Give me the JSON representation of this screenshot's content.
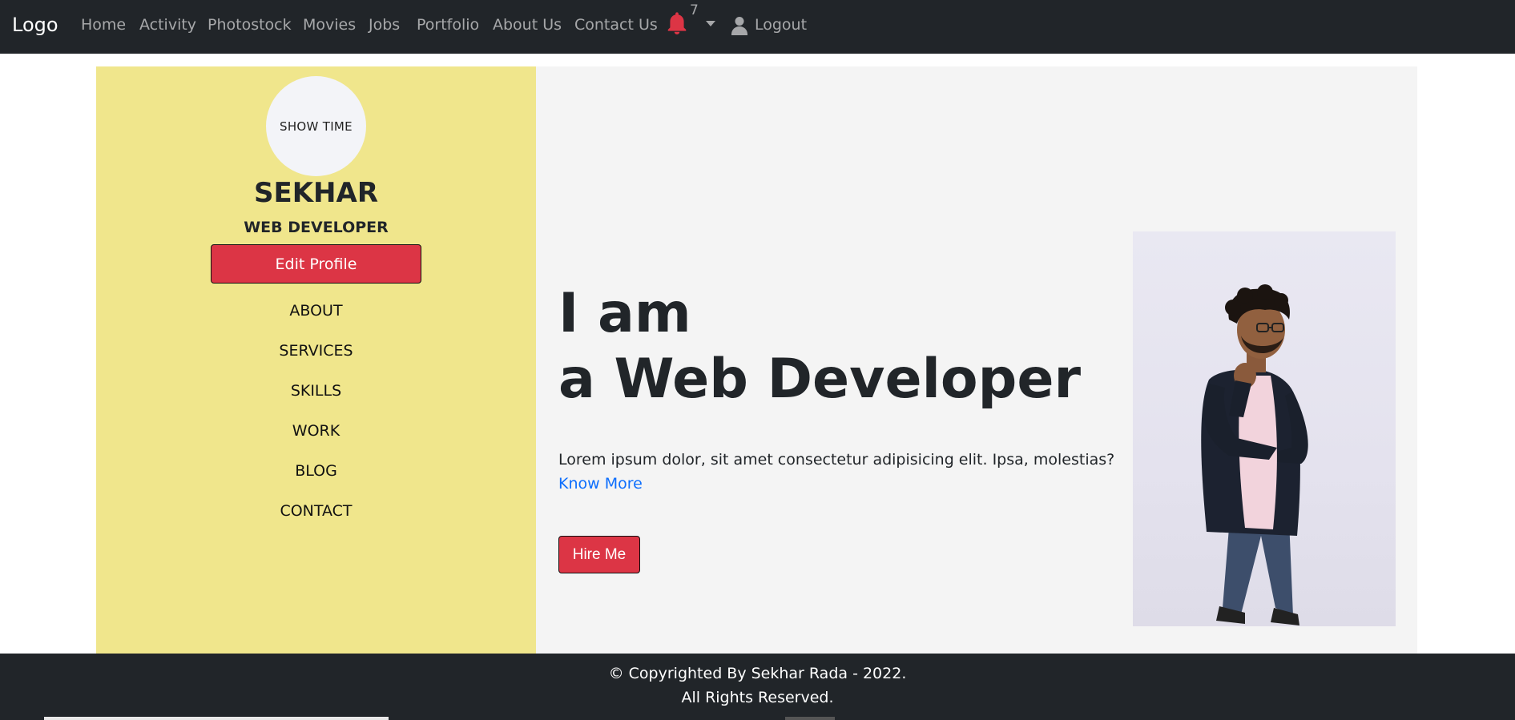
{
  "navbar": {
    "brand": "Logo",
    "links": [
      "Home",
      "Activity",
      "Photostock",
      "Movies",
      "Jobs",
      "Portfolio",
      "About Us",
      "Contact Us"
    ],
    "notification_count": "7",
    "logout_label": "Logout",
    "icons": [
      "bell-icon",
      "chevron-down-icon",
      "user-icon"
    ]
  },
  "sidebar": {
    "avatar_text": "SHOW TIME",
    "name": "SEKHAR",
    "role": "WEB DEVELOPER",
    "edit_label": "Edit Profile",
    "menu": [
      "ABOUT",
      "SERVICES",
      "SKILLS",
      "WORK",
      "BLOG",
      "CONTACT"
    ]
  },
  "hero": {
    "line1": "I am",
    "line2": "a Web Developer",
    "description": "Lorem ipsum dolor, sit amet consectetur adipisicing elit. Ipsa, molestias?",
    "know_more": "Know More",
    "hire_label": "Hire Me"
  },
  "footer": {
    "line1": "© Copyrighted By Sekhar Rada - 2022.",
    "line2": "All Rights Reserved."
  },
  "colors": {
    "navbar_bg": "#212529",
    "sidebar_bg": "#f0e68c",
    "main_bg": "#f4f4f4",
    "accent_red": "#dc3545",
    "link_blue": "#0d6efd"
  }
}
